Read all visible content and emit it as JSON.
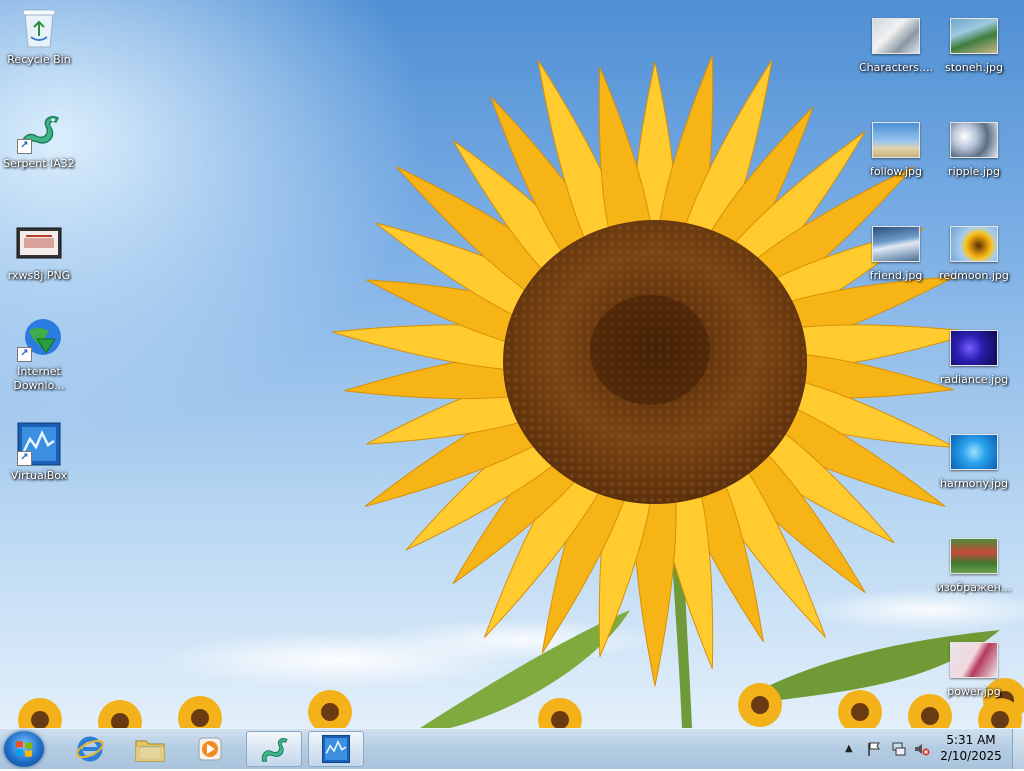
{
  "desktop": {
    "left_icons": [
      {
        "label": "Recycle Bin",
        "icon": "recycle-bin-icon"
      },
      {
        "label": "Serpent IA32",
        "icon": "serpent-icon",
        "shortcut": true
      },
      {
        "label": "rxws8j.PNG",
        "icon": "image-file-icon"
      },
      {
        "label": "Internet Downlo...",
        "icon": "internet-download-manager-icon",
        "shortcut": true
      },
      {
        "label": "VirtualBox",
        "icon": "virtualbox-icon",
        "shortcut": true
      }
    ],
    "right_icons": [
      {
        "label": "Characters....",
        "icon": "image-thumbnail-icon"
      },
      {
        "label": "stoneh.jpg",
        "icon": "image-thumbnail-icon"
      },
      {
        "label": "follow.jpg",
        "icon": "image-thumbnail-icon"
      },
      {
        "label": "ripple.jpg",
        "icon": "image-thumbnail-icon"
      },
      {
        "label": "friend.jpg",
        "icon": "image-thumbnail-icon"
      },
      {
        "label": "redmoon.jpg",
        "icon": "image-thumbnail-icon"
      },
      {
        "label": "radiance.jpg",
        "icon": "image-thumbnail-icon"
      },
      {
        "label": "harmony.jpg",
        "icon": "image-thumbnail-icon"
      },
      {
        "label": "изображен...",
        "icon": "image-thumbnail-icon"
      },
      {
        "label": "power.jpg",
        "icon": "image-thumbnail-icon"
      }
    ]
  },
  "taskbar": {
    "start_icon": "windows-start-icon",
    "pinned": [
      {
        "icon": "internet-explorer-icon"
      },
      {
        "icon": "file-explorer-icon"
      },
      {
        "icon": "media-player-icon"
      },
      {
        "icon": "serpent-icon",
        "active": true
      },
      {
        "icon": "virtualbox-icon",
        "active": true
      }
    ],
    "tray": {
      "icons": [
        "show-hidden-icons-chevron",
        "action-center-flag-icon",
        "network-icon",
        "volume-muted-icon"
      ],
      "time": "5:31 AM",
      "date": "2/10/2025"
    }
  },
  "colors": {
    "sky": "#7fb1e6",
    "petal": "#f7b814",
    "disk": "#6a3a12",
    "taskbar": "#b5cde3"
  }
}
